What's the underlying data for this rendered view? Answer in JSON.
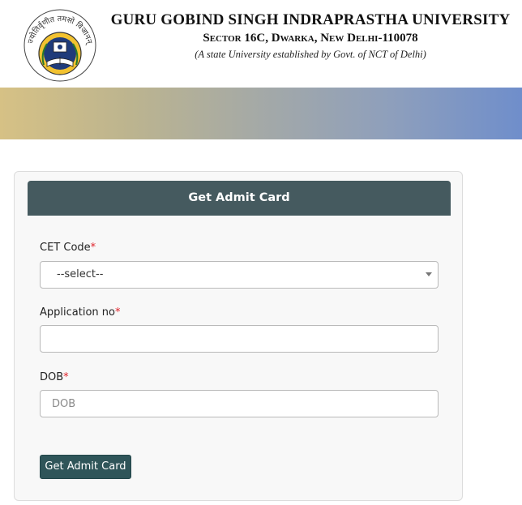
{
  "header": {
    "university_name": "GURU GOBIND SINGH INDRAPRASTHA UNIVERSITY",
    "address": "Sector 16C, Dwarka, New Delhi-110078",
    "tagline": "(A state University established by Govt. of NCT of Delhi)",
    "logo_motto": "ज्योतिर्वृणीत तमसो विजानन्",
    "logo_icon": "university-emblem"
  },
  "colors": {
    "card_header": "#455a5f",
    "button": "#2f5559",
    "required": "#e0232b",
    "banner_start": "#d6c185",
    "banner_end": "#6f8ecb"
  },
  "form": {
    "title": "Get Admit Card",
    "cet_code": {
      "label": "CET Code",
      "required_mark": "*",
      "selected": "--select--"
    },
    "application_no": {
      "label": "Application no",
      "required_mark": "*",
      "value": "",
      "placeholder": ""
    },
    "dob": {
      "label": "DOB",
      "required_mark": "*",
      "value": "",
      "placeholder": "DOB"
    },
    "submit_label": "Get Admit Card"
  }
}
